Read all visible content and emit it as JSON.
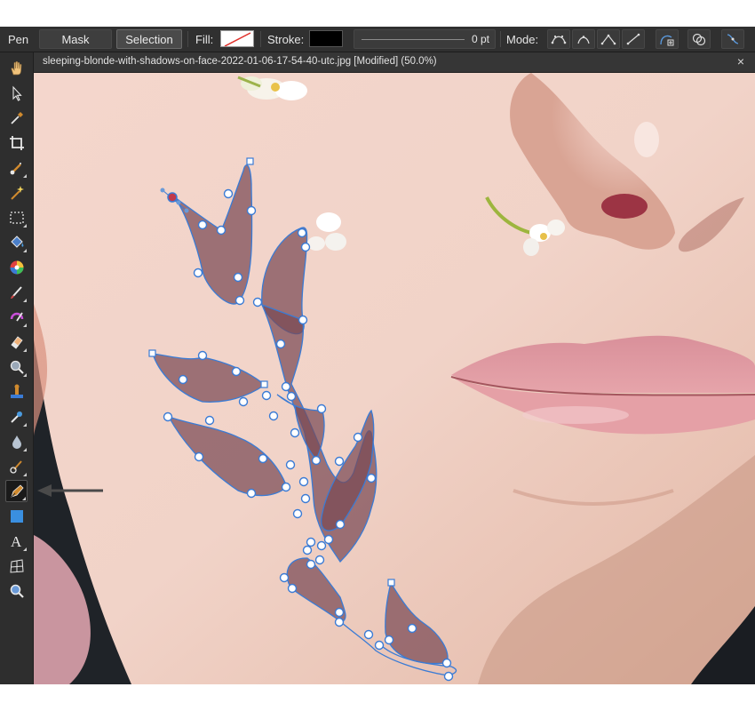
{
  "toolbar": {
    "tool_name": "Pen",
    "mask_label": "Mask",
    "selection_label": "Selection",
    "fill_label": "Fill:",
    "stroke_label": "Stroke:",
    "stroke_width": "0 pt",
    "mode_label": "Mode:",
    "mode_icons": [
      "pen-mode-icon",
      "smart-mode-icon",
      "polygon-mode-icon",
      "line-mode-icon"
    ],
    "fill_color": "none",
    "stroke_color": "#000000"
  },
  "document": {
    "title": "sleeping-blonde-with-shadows-on-face-2022-01-06-17-54-40-utc.jpg [Modified] (50.0%)",
    "close_glyph": "×"
  },
  "tools": [
    {
      "name": "hand-tool",
      "icon": "hand-icon"
    },
    {
      "name": "move-tool",
      "icon": "pointer-icon"
    },
    {
      "name": "color-picker-tool",
      "icon": "eyedropper-icon"
    },
    {
      "name": "crop-tool",
      "icon": "crop-icon"
    },
    {
      "name": "selection-brush-tool",
      "icon": "selection-brush-icon"
    },
    {
      "name": "flood-select-tool",
      "icon": "magic-wand-icon"
    },
    {
      "name": "marquee-tool",
      "icon": "marquee-icon"
    },
    {
      "name": "flood-fill-tool",
      "icon": "paint-bucket-icon"
    },
    {
      "name": "gradient-tool",
      "icon": "color-wheel-icon"
    },
    {
      "name": "paint-brush-tool",
      "icon": "brush-icon"
    },
    {
      "name": "color-replacement-tool",
      "icon": "color-brush-icon"
    },
    {
      "name": "erase-brush-tool",
      "icon": "eraser-icon"
    },
    {
      "name": "dodge-tool",
      "icon": "dodge-icon"
    },
    {
      "name": "clone-brush-tool",
      "icon": "stamp-icon"
    },
    {
      "name": "healing-brush-tool",
      "icon": "healing-icon"
    },
    {
      "name": "blur-brush-tool",
      "icon": "droplet-icon"
    },
    {
      "name": "smudge-brush-tool",
      "icon": "smudge-icon"
    },
    {
      "name": "pen-tool",
      "icon": "pen-nib-icon",
      "active": true
    },
    {
      "name": "rectangle-tool",
      "icon": "rectangle-icon"
    },
    {
      "name": "artistic-text-tool",
      "icon": "text-icon"
    },
    {
      "name": "mesh-warp-tool",
      "icon": "mesh-warp-icon"
    },
    {
      "name": "zoom-tool",
      "icon": "magnifier-icon"
    }
  ],
  "colors": {
    "accent_path": "#3a7bd5",
    "shape_fill": "#7a4a55",
    "app_bg": "#2b2b2b"
  }
}
